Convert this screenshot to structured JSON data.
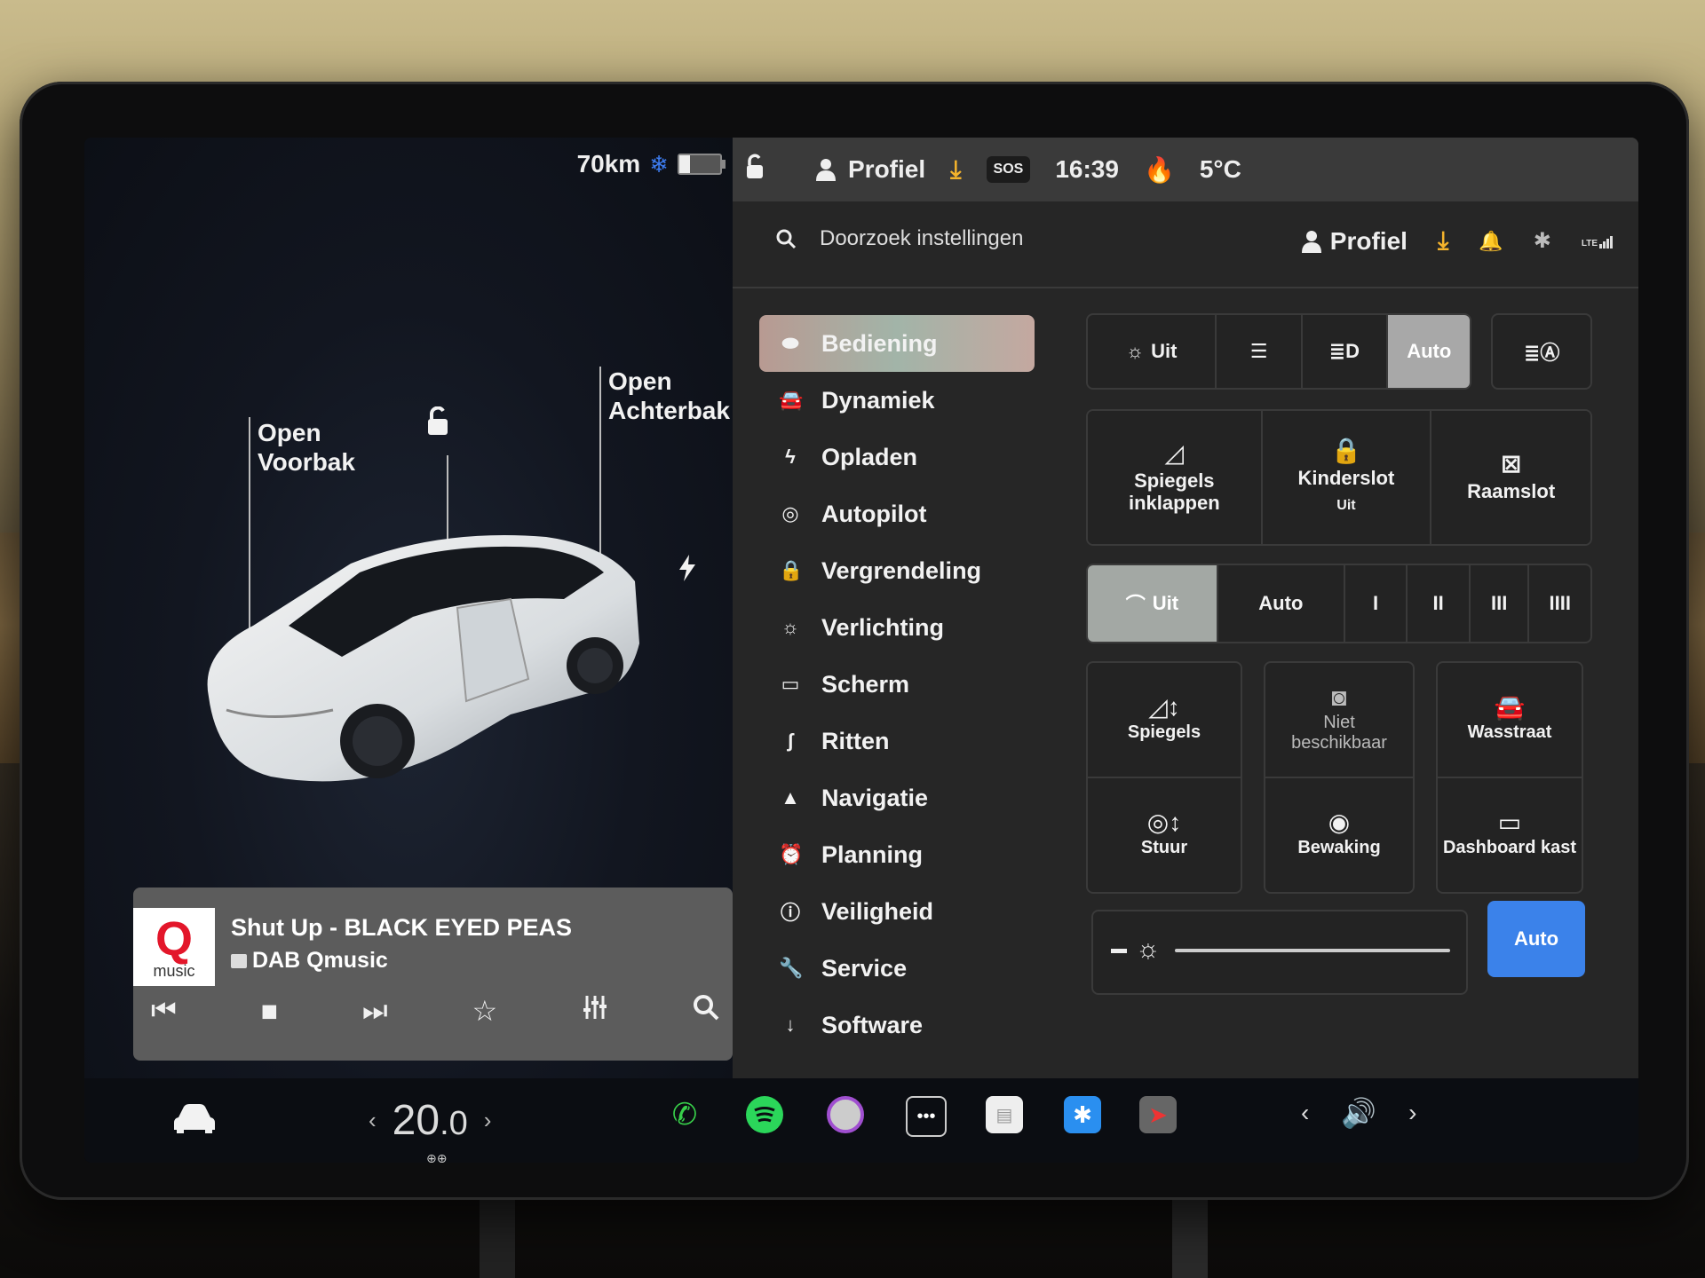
{
  "status_bar": {
    "range": "70km",
    "snowflake_icon": "❄",
    "profile_label": "Profiel",
    "sos_label": "SOS",
    "time": "16:39",
    "temperature": "5°C"
  },
  "car_view": {
    "frunk_label_line1": "Open",
    "frunk_label_line2": "Voorbak",
    "trunk_label_line1": "Open",
    "trunk_label_line2": "Achterbak"
  },
  "media": {
    "logo_q": "Q",
    "logo_text": "music",
    "track": "Shut Up - BLACK EYED PEAS",
    "station": "DAB Qmusic"
  },
  "climate": {
    "temperature_int": "20",
    "temperature_dec": ".0"
  },
  "settings": {
    "search_placeholder": "Doorzoek instellingen",
    "profile_label": "Profiel",
    "lte_label": "LTE",
    "sidebar": [
      {
        "label": "Bediening",
        "icon": "toggle-icon",
        "active": true
      },
      {
        "label": "Dynamiek",
        "icon": "car-icon"
      },
      {
        "label": "Opladen",
        "icon": "bolt-icon"
      },
      {
        "label": "Autopilot",
        "icon": "steering-wheel-icon"
      },
      {
        "label": "Vergrendeling",
        "icon": "lock-icon"
      },
      {
        "label": "Verlichting",
        "icon": "sun-icon"
      },
      {
        "label": "Scherm",
        "icon": "display-icon"
      },
      {
        "label": "Ritten",
        "icon": "trips-icon"
      },
      {
        "label": "Navigatie",
        "icon": "navigation-icon"
      },
      {
        "label": "Planning",
        "icon": "alarm-icon"
      },
      {
        "label": "Veiligheid",
        "icon": "alert-icon"
      },
      {
        "label": "Service",
        "icon": "wrench-icon"
      },
      {
        "label": "Software",
        "icon": "download-icon"
      }
    ],
    "lights": {
      "off_label": "Uit",
      "auto_label": "Auto",
      "selected": "Auto"
    },
    "quick_tiles": [
      {
        "label_line1": "Spiegels",
        "label_line2": "inklappen"
      },
      {
        "label_line1": "Kinderslot",
        "sub": "Uit"
      },
      {
        "label_line1": "Raamslot"
      }
    ],
    "wipers": {
      "off_label": "Uit",
      "auto_label": "Auto",
      "speeds": [
        "I",
        "II",
        "III",
        "IIII"
      ],
      "selected": "Uit"
    },
    "tiles": [
      {
        "label": "Spiegels"
      },
      {
        "label": "Stuur"
      },
      {
        "label_line1": "Niet",
        "label_line2": "beschikbaar",
        "disabled": true
      },
      {
        "label": "Bewaking"
      },
      {
        "label": "Wasstraat"
      },
      {
        "label": "Dashboard kast"
      }
    ],
    "brightness": {
      "auto_label": "Auto",
      "auto_active": true
    }
  }
}
